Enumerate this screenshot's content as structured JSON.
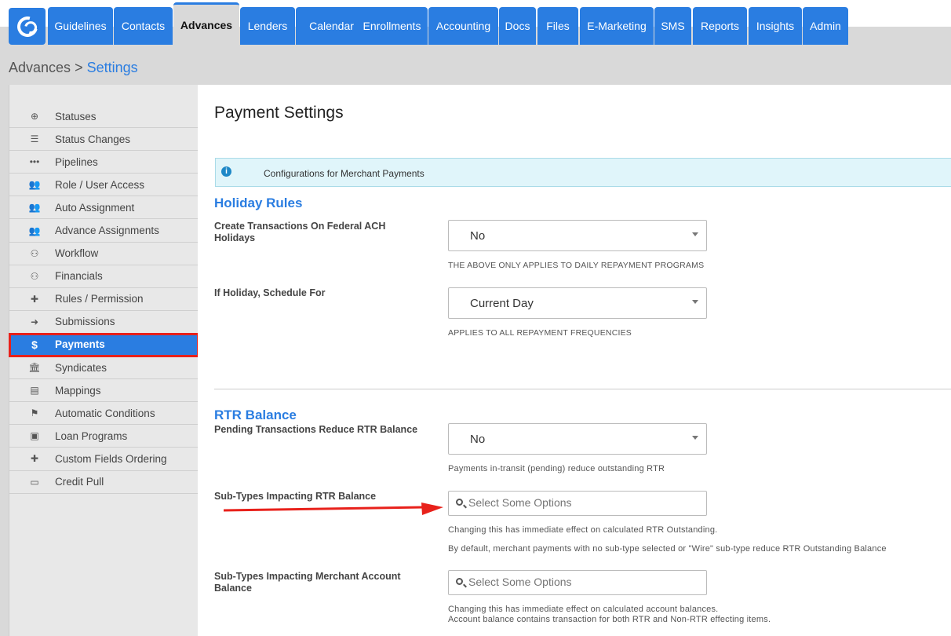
{
  "nav": {
    "tabs": [
      {
        "label": "Guidelines",
        "active": false
      },
      {
        "label": "Contacts",
        "active": false
      },
      {
        "label": "Advances",
        "active": true
      },
      {
        "label": "Lenders",
        "active": false
      },
      {
        "label": "Calendar",
        "active": false
      },
      {
        "label": "Enrollments",
        "active": false
      },
      {
        "label": "Accounting",
        "active": false
      },
      {
        "label": "Docs",
        "active": false
      },
      {
        "label": "Files",
        "active": false
      },
      {
        "label": "E-Marketing",
        "active": false
      },
      {
        "label": "SMS",
        "active": false
      },
      {
        "label": "Reports",
        "active": false
      },
      {
        "label": "Insights",
        "active": false
      },
      {
        "label": "Admin",
        "active": false
      }
    ]
  },
  "breadcrumb": {
    "parent": "Advances",
    "separator": ">",
    "current": "Settings"
  },
  "sidebar": {
    "items": [
      {
        "label": "Statuses",
        "icon": "plus-circle-icon"
      },
      {
        "label": "Status Changes",
        "icon": "bars-icon"
      },
      {
        "label": "Pipelines",
        "icon": "ellipsis-icon"
      },
      {
        "label": "Role / User Access",
        "icon": "users-icon"
      },
      {
        "label": "Auto Assignment",
        "icon": "users-icon"
      },
      {
        "label": "Advance Assignments",
        "icon": "users-icon"
      },
      {
        "label": "Workflow",
        "icon": "sitemap-icon"
      },
      {
        "label": "Financials",
        "icon": "sitemap-icon"
      },
      {
        "label": "Rules / Permission",
        "icon": "puzzle-icon"
      },
      {
        "label": "Submissions",
        "icon": "arrow-circle-icon"
      },
      {
        "label": "Payments",
        "icon": "dollar-icon",
        "active": true
      },
      {
        "label": "Syndicates",
        "icon": "bank-icon"
      },
      {
        "label": "Mappings",
        "icon": "file-icon"
      },
      {
        "label": "Automatic Conditions",
        "icon": "flag-icon"
      },
      {
        "label": "Loan Programs",
        "icon": "briefcase-icon"
      },
      {
        "label": "Custom Fields Ordering",
        "icon": "puzzle-icon"
      },
      {
        "label": "Credit Pull",
        "icon": "credit-card-icon"
      }
    ]
  },
  "main": {
    "title": "Payment Settings",
    "alert": "Configurations for Merchant Payments",
    "holiday": {
      "heading": "Holiday Rules",
      "federal_label": "Create Transactions On Federal ACH Holidays",
      "federal_value": "No",
      "federal_help": "THE ABOVE ONLY APPLIES TO DAILY REPAYMENT PROGRAMS",
      "schedule_label": "If Holiday, Schedule For",
      "schedule_value": "Current Day",
      "schedule_help": "APPLIES TO ALL REPAYMENT FREQUENCIES"
    },
    "rtr": {
      "heading": "RTR Balance",
      "pending_label": "Pending Transactions Reduce RTR Balance",
      "pending_value": "No",
      "pending_help": "Payments in-transit (pending) reduce outstanding RTR",
      "subtypes_label": "Sub-Types Impacting RTR Balance",
      "subtypes_placeholder": "Select Some Options",
      "subtypes_help1": "Changing this has immediate effect on calculated RTR Outstanding.",
      "subtypes_help2": "By default, merchant payments with no sub-type selected or \"Wire\" sub-type reduce RTR Outstanding Balance",
      "merchant_label": "Sub-Types Impacting Merchant Account Balance",
      "merchant_placeholder": "Select Some Options",
      "merchant_help1": "Changing this has immediate effect on calculated account balances.",
      "merchant_help2": "Account balance contains transaction for both RTR and Non-RTR effecting items."
    }
  },
  "colors": {
    "accent": "#2a7de1",
    "highlight_border": "#e8211b",
    "annotation_arrow": "#e8211b"
  }
}
